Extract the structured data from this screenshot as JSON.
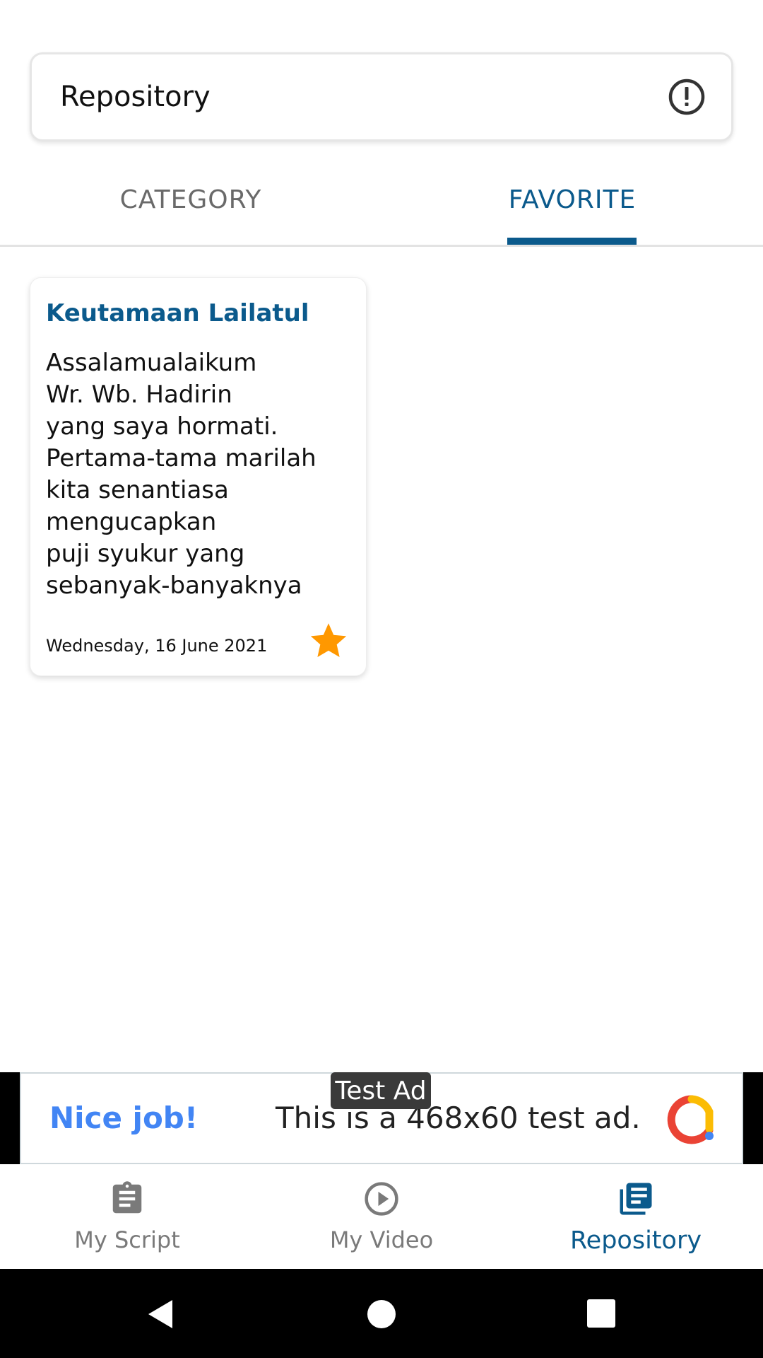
{
  "header": {
    "title": "Repository"
  },
  "tabs": [
    {
      "label": "CATEGORY",
      "active": false
    },
    {
      "label": "FAVORITE",
      "active": true
    }
  ],
  "scripts": [
    {
      "title": "Keutamaan Lailatul",
      "body_lines": [
        "Assalamualaikum",
        "Wr. Wb. Hadirin",
        "yang saya hormati.",
        "Pertama-tama marilah",
        "kita senantiasa",
        "mengucapkan",
        "puji syukur yang",
        "sebanyak-banyaknya"
      ],
      "date": "Wednesday, 16 June 2021",
      "favorite": true
    }
  ],
  "ad": {
    "badge": "Test Ad",
    "headline": "Nice job!",
    "text": "This is a 468x60 test ad."
  },
  "bottom_nav": [
    {
      "label": "My Script",
      "icon": "clipboard-icon",
      "active": false
    },
    {
      "label": "My Video",
      "icon": "play-circle-icon",
      "active": false
    },
    {
      "label": "Repository",
      "icon": "library-books-icon",
      "active": true
    }
  ],
  "colors": {
    "primary": "#0b5a8c",
    "star": "#ff9800",
    "ad_headline": "#4285f4"
  }
}
